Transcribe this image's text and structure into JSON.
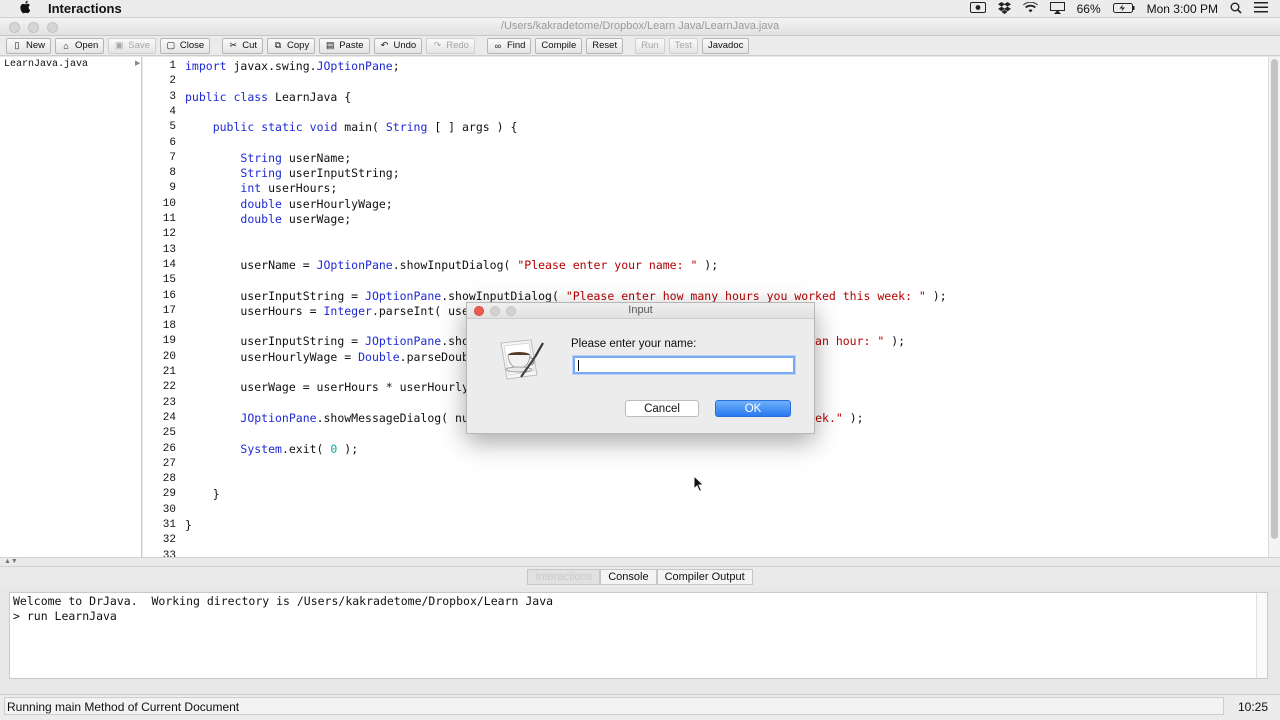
{
  "menubar": {
    "app_name": "Interactions",
    "battery": "66%",
    "clock": "Mon 3:00 PM"
  },
  "window": {
    "title": "/Users/kakradetome/Dropbox/Learn Java/LearnJava.java"
  },
  "toolbar": {
    "new": "New",
    "open": "Open",
    "save": "Save",
    "close": "Close",
    "cut": "Cut",
    "copy": "Copy",
    "paste": "Paste",
    "undo": "Undo",
    "redo": "Redo",
    "find": "Find",
    "compile": "Compile",
    "reset": "Reset",
    "run": "Run",
    "test": "Test",
    "javadoc": "Javadoc"
  },
  "doclist": {
    "items": [
      "LearnJava.java"
    ]
  },
  "editor": {
    "line_numbers": [
      "1",
      "2",
      "3",
      "4",
      "5",
      "6",
      "7",
      "8",
      "9",
      "10",
      "11",
      "12",
      "13",
      "14",
      "15",
      "16",
      "17",
      "18",
      "19",
      "20",
      "21",
      "22",
      "23",
      "24",
      "25",
      "26",
      "27",
      "28",
      "29",
      "30",
      "31",
      "32",
      "33"
    ],
    "lines": [
      "import javax.swing.JOptionPane;",
      "",
      "public class LearnJava {",
      "",
      "    public static void main( String [ ] args ) {",
      "",
      "        String userName;",
      "        String userInputString;",
      "        int userHours;",
      "        double userHourlyWage;",
      "        double userWage;",
      "",
      "",
      "        userName = JOptionPane.showInputDialog( \"Please enter your name: \" );",
      "",
      "        userInputString = JOptionPane.showInputDialog( \"Please enter how many hours you worked this week: \" );",
      "        userHours = Integer.parseInt( userInputString );",
      "",
      "        userInputString = JOptionPane.showInputDialog( \"Please enter how much you are paid an hour: \" );",
      "        userHourlyWage = Double.parseDouble( userInputString );",
      "",
      "        userWage = userHours * userHourlyWage;",
      "",
      "        JOptionPane.showMessageDialog( null, userName + \" you made \" + userWage + \" this week.\" );",
      "",
      "        System.exit( 0 );",
      "",
      "",
      "    }",
      "",
      "}",
      "",
      ""
    ]
  },
  "tabs": {
    "interactions": "Interactions",
    "console": "Console",
    "compiler_output": "Compiler Output"
  },
  "interactions_pane": {
    "lines": [
      "Welcome to DrJava.  Working directory is /Users/kakradetome/Dropbox/Learn Java",
      "> run LearnJava"
    ]
  },
  "statusbar": {
    "message": "Running main Method of Current Document",
    "position": "10:25"
  },
  "dialog": {
    "title": "Input",
    "prompt": "Please enter your name:",
    "input_value": "",
    "cancel_label": "Cancel",
    "ok_label": "OK"
  },
  "colors": {
    "keyword": "#1e2ad4",
    "string": "#b40000",
    "number": "#0aa8a0",
    "ok_button": "#2979f1"
  }
}
